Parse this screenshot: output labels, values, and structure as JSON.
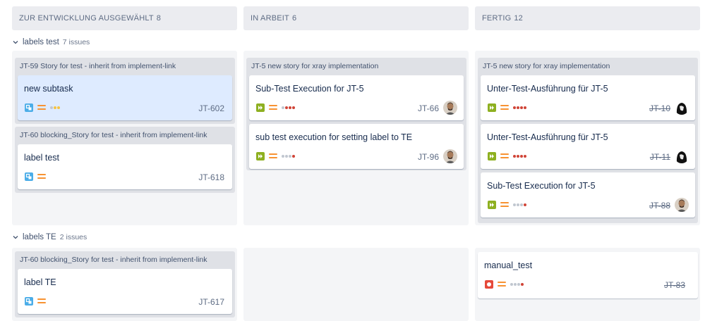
{
  "columns": [
    {
      "title": "ZUR ENTWICKLUNG AUSGEWÄHLT",
      "count": "8"
    },
    {
      "title": "IN ARBEIT",
      "count": "6"
    },
    {
      "title": "FERTIG",
      "count": "12"
    }
  ],
  "swimlanes": [
    {
      "title": "labels test",
      "count": "7 issues"
    },
    {
      "title": "labels TE",
      "count": "2 issues"
    }
  ],
  "groups": {
    "g1": "JT-59 Story for test - inherit from implement-link",
    "g2": "JT-60 blocking_Story for test - inherit from implement-link",
    "g3": "JT-5 new story for xray implementation",
    "g4": "JT-5 new story for xray implementation",
    "g5": "JT-60 blocking_Story for test - inherit from implement-link"
  },
  "cards": {
    "c1": {
      "title": "new subtask",
      "key": "JT-602",
      "type_icon": "subtask-icon",
      "priority_icon": "medium-priority-icon"
    },
    "c2": {
      "title": "label test",
      "key": "JT-618",
      "type_icon": "subtask-icon",
      "priority_icon": "medium-priority-icon"
    },
    "c3": {
      "title": "Sub-Test Execution for JT-5",
      "key": "JT-66",
      "type_icon": "test-execution-icon",
      "priority_icon": "medium-priority-icon"
    },
    "c4": {
      "title": "sub test execution for setting label to TE",
      "key": "JT-96",
      "type_icon": "test-execution-icon",
      "priority_icon": "medium-priority-icon"
    },
    "c5": {
      "title": "Unter-Test-Ausführung für JT-5",
      "key": "JT-10",
      "type_icon": "test-execution-icon",
      "priority_icon": "medium-priority-icon"
    },
    "c6": {
      "title": "Unter-Test-Ausführung für JT-5",
      "key": "JT-11",
      "type_icon": "test-execution-icon",
      "priority_icon": "medium-priority-icon"
    },
    "c7": {
      "title": "Sub-Test Execution for JT-5",
      "key": "JT-88",
      "type_icon": "test-execution-icon",
      "priority_icon": "medium-priority-icon"
    },
    "c8": {
      "title": "label TE",
      "key": "JT-617",
      "type_icon": "subtask-icon",
      "priority_icon": "medium-priority-icon"
    },
    "c9": {
      "title": "manual_test",
      "key": "JT-83",
      "type_icon": "bug-icon",
      "priority_icon": "medium-priority-icon"
    }
  },
  "colors": {
    "subtask": "#4bade8",
    "test_execution": "#8eb021",
    "bug": "#e5493a",
    "priority_medium": "#f79232",
    "estimate_red": "#d04437",
    "estimate_yellow": "#f6c342",
    "estimate_grey": "#c1c7d0"
  }
}
